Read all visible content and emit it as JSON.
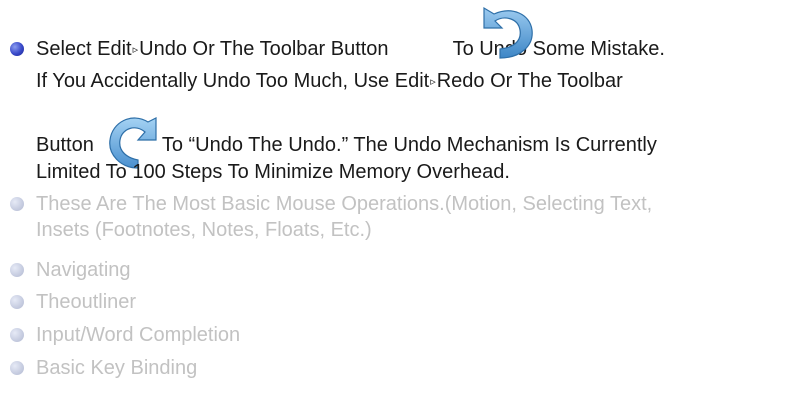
{
  "main_item": {
    "line1": {
      "part_a": "Select Edit",
      "arrow1": "▹",
      "part_b": "Undo Or The Toolbar Button",
      "part_c": "To Undo Some Mistake."
    },
    "line2": {
      "part_a": "If You Accidentally Undo Too Much, Use Edit",
      "arrow2": "▹",
      "part_b": "Redo Or The Toolbar"
    },
    "line3": {
      "part_a": "Button",
      "part_b": "To “Undo The Undo.” The Undo Mechanism Is Currently"
    },
    "line4": "Limited To 100 Steps To Minimize Memory Overhead.",
    "undo_icon": "undo-icon",
    "redo_icon": "redo-icon"
  },
  "dim_items": [
    {
      "line1": "These Are The Most Basic Mouse Operations.(Motion, Selecting Text,",
      "line2": "Insets (Footnotes, Notes, Floats, Etc.)"
    },
    {
      "line1": "Navigating"
    },
    {
      "line1": "Theoutliner"
    },
    {
      "line1": "Input/Word Completion"
    },
    {
      "line1": "Basic Key Binding"
    }
  ],
  "colors": {
    "active_bullet": "#3848c8",
    "dim_bullet": "#c6cce0",
    "text": "#1a1a1a",
    "dim_text": "#c2c2c2",
    "icon_blue": "#5aa0d8"
  }
}
